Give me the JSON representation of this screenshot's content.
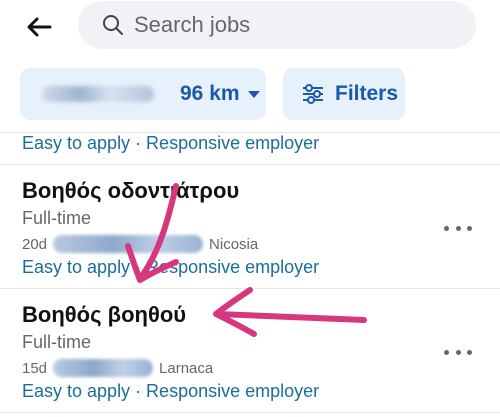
{
  "search": {
    "placeholder": "Search jobs"
  },
  "filters": {
    "distance": "96 km",
    "filters_label": "Filters"
  },
  "partial_job": {
    "apply_info": "Easy to apply · Responsive employer"
  },
  "jobs": [
    {
      "title": "Βοηθός οδοντιάτρου",
      "type": "Full-time",
      "age": "20d",
      "location": "Nicosia",
      "apply_info": "Easy to apply · Responsive employer"
    },
    {
      "title": "Βοηθός βοηθού",
      "type": "Full-time",
      "age": "15d",
      "location": "Larnaca",
      "apply_info": "Easy to apply · Responsive employer"
    }
  ],
  "colors": {
    "accent": "#1a5aa9",
    "link": "#1a6e9b",
    "annotation": "#d6377e"
  },
  "icons": [
    "back-arrow-icon",
    "search-icon",
    "caret-down-icon",
    "sliders-icon",
    "more-icon"
  ]
}
